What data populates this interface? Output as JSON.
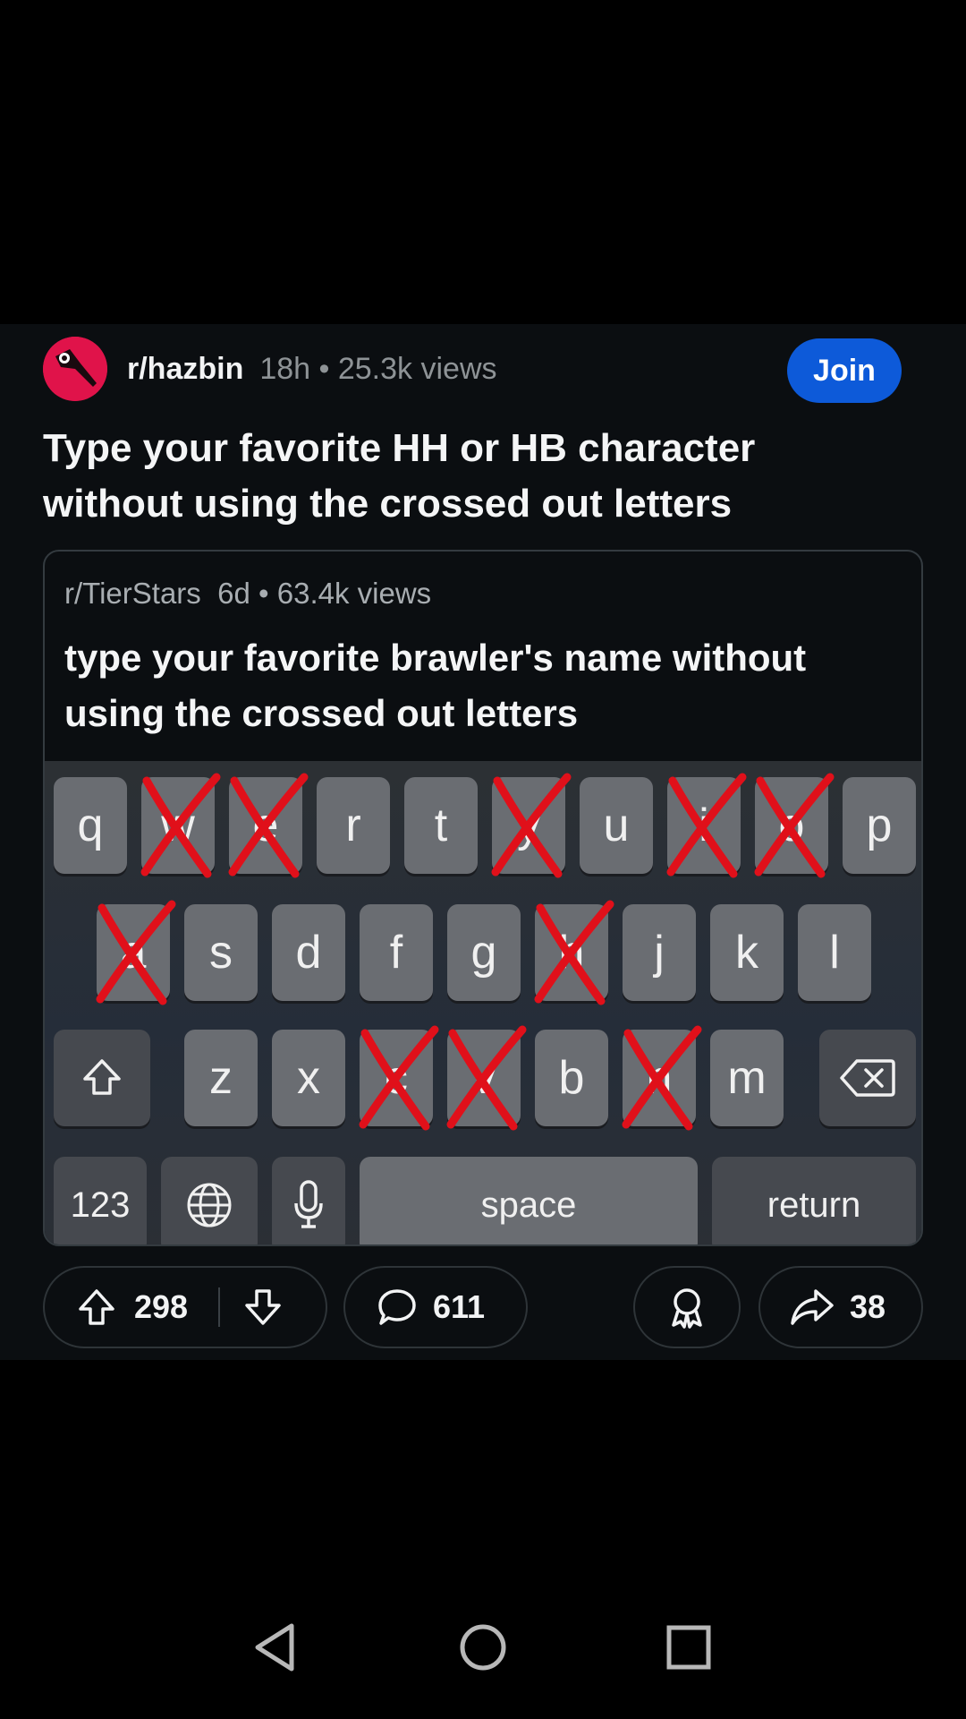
{
  "post": {
    "subreddit": "r/hazbin",
    "meta": "18h • 25.3k views",
    "join_label": "Join",
    "title": "Type your favorite HH or HB character without using the crossed out letters"
  },
  "embed": {
    "subreddit": "r/TierStars",
    "meta": "6d • 63.4k views",
    "title": "type your favorite brawler's name without using the crossed out letters"
  },
  "keyboard": {
    "row1": [
      "q",
      "w",
      "e",
      "r",
      "t",
      "y",
      "u",
      "i",
      "o",
      "p"
    ],
    "row2": [
      "a",
      "s",
      "d",
      "f",
      "g",
      "h",
      "j",
      "k",
      "l"
    ],
    "row3": [
      "z",
      "x",
      "c",
      "v",
      "b",
      "n",
      "m"
    ],
    "crossed": [
      "w",
      "e",
      "y",
      "i",
      "o",
      "a",
      "h",
      "c",
      "v",
      "n"
    ],
    "num_label": "123",
    "space_label": "space",
    "return_label": "return"
  },
  "actions": {
    "upvotes": "298",
    "comments": "611",
    "shares": "38"
  },
  "icons": {
    "accent": "#0d5ad9",
    "cross_color": "#e0101a",
    "avatar_color": "#e0134a"
  }
}
